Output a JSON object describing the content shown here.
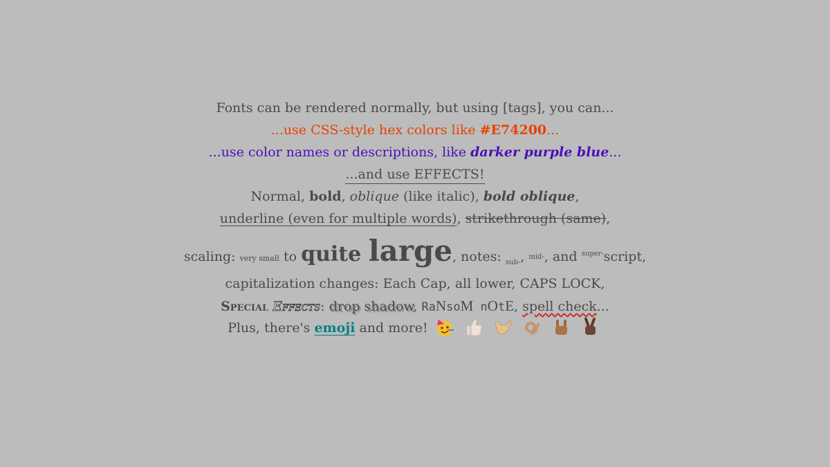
{
  "lines": {
    "l1": "Fonts can be rendered normally, but using [tags], you can...",
    "l2a": "...use CSS-style hex colors like ",
    "l2b": "#E74200",
    "l2c": "...",
    "l3a": "...use color names or descriptions, like ",
    "l3b": "darker purple blue",
    "l3c": "...",
    "l4": "...and use EFFECTS!",
    "l5a": "Normal, ",
    "l5b": "bold",
    "l5c": ", ",
    "l5d": "oblique",
    "l5e": " (like italic), ",
    "l5f": "bold oblique",
    "l5g": ",",
    "l6a": "underline (even for multiple words)",
    "l6b": ", ",
    "l6c": "strikethrough (same)",
    "l6d": ",",
    "l7a": "scaling: ",
    "l7b": "very small",
    "l7c": " to ",
    "l7d": "quite ",
    "l7e": "large",
    "l7f": ", notes: ",
    "l7g": "sub-",
    "l7h": ", ",
    "l7i": "mid-",
    "l7j": ", and ",
    "l7k": "super-",
    "l7l": "script,",
    "l8": "capitalization changes: Each Cap, all lower, CAPS LOCK,",
    "l9a": "Special",
    "l9b": " ",
    "l9c": "Effects",
    "l9d": ": ",
    "l9e": "drop shadow",
    "l9f": ", ",
    "l9g1": "Ra",
    "l9g2": "N",
    "l9g3": "so",
    "l9g4": "M",
    "l9g5": " n",
    "l9g6": "O",
    "l9g7": "t",
    "l9g8": "E",
    "l9h": ", ",
    "l9i": "spell check",
    "l9j": "...",
    "l10a": "Plus, there's ",
    "l10b": "emoji",
    "l10c": " and more!"
  },
  "emoji": [
    {
      "icon": "partying-face-icon"
    },
    {
      "icon": "thumbs-up-light-icon"
    },
    {
      "icon": "call-me-hand-medium-light-icon"
    },
    {
      "icon": "ok-hand-medium-icon"
    },
    {
      "icon": "sign-of-horns-medium-dark-icon"
    },
    {
      "icon": "victory-hand-dark-icon"
    }
  ],
  "colors": {
    "background": "#bcbcbc",
    "text": "#4a4a4a",
    "hex_example": "#e74200",
    "purple_blue": "#4a10b8",
    "emoji_link": "#00808a"
  }
}
